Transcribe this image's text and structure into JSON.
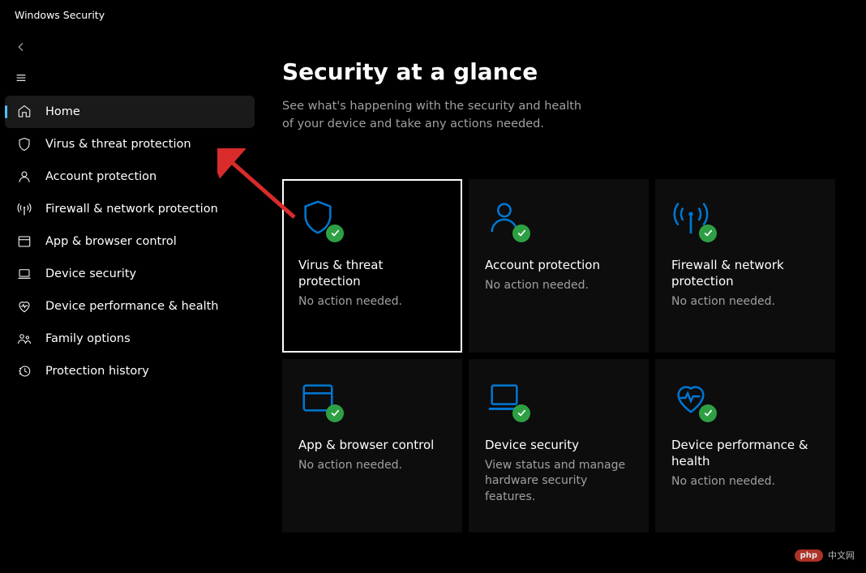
{
  "app_title": "Windows Security",
  "nav": {
    "items": [
      {
        "id": "home",
        "label": "Home",
        "active": true
      },
      {
        "id": "virus",
        "label": "Virus & threat protection",
        "active": false
      },
      {
        "id": "account",
        "label": "Account protection",
        "active": false
      },
      {
        "id": "firewall",
        "label": "Firewall & network protection",
        "active": false
      },
      {
        "id": "app",
        "label": "App & browser control",
        "active": false
      },
      {
        "id": "device",
        "label": "Device security",
        "active": false
      },
      {
        "id": "perf",
        "label": "Device performance & health",
        "active": false
      },
      {
        "id": "family",
        "label": "Family options",
        "active": false
      },
      {
        "id": "history",
        "label": "Protection history",
        "active": false
      }
    ]
  },
  "main": {
    "title": "Security at a glance",
    "subtitle": "See what's happening with the security and health of your device and take any actions needed."
  },
  "cards": [
    {
      "id": "virus",
      "title": "Virus & threat protection",
      "status": "No action needed.",
      "selected": true,
      "badge": "ok"
    },
    {
      "id": "account",
      "title": "Account protection",
      "status": "No action needed.",
      "selected": false,
      "badge": "ok"
    },
    {
      "id": "firewall",
      "title": "Firewall & network protection",
      "status": "No action needed.",
      "selected": false,
      "badge": "ok"
    },
    {
      "id": "app",
      "title": "App & browser control",
      "status": "No action needed.",
      "selected": false,
      "badge": "ok"
    },
    {
      "id": "device",
      "title": "Device security",
      "status": "View status and manage hardware security features.",
      "selected": false,
      "badge": "ok"
    },
    {
      "id": "perf",
      "title": "Device performance & health",
      "status": "No action needed.",
      "selected": false,
      "badge": "ok"
    }
  ],
  "watermark": {
    "badge": "php",
    "text": "中文网"
  }
}
